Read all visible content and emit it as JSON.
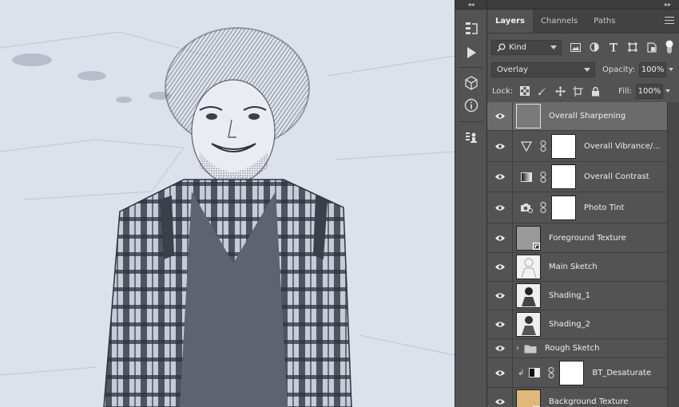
{
  "panel": {
    "tabs": [
      {
        "label": "Layers",
        "active": true
      },
      {
        "label": "Channels",
        "active": false
      },
      {
        "label": "Paths",
        "active": false
      }
    ],
    "filter_kind": "Kind",
    "blend_mode": "Overlay",
    "opacity_label": "Opacity:",
    "opacity_value": "100%",
    "lock_label": "Lock:",
    "fill_label": "Fill:",
    "fill_value": "100%"
  },
  "layers": [
    {
      "name": "Overall Sharpening",
      "selected": true,
      "kind": "pixel",
      "thumb_color": "#7a7a7a"
    },
    {
      "name": "Overall Vibrance/...",
      "kind": "adjustment",
      "adj_icon": "vibrance-triangle-icon"
    },
    {
      "name": "Overall Contrast",
      "kind": "adjustment",
      "adj_icon": "gradient-map-icon"
    },
    {
      "name": "Photo Tint",
      "kind": "adjustment",
      "adj_icon": "camera-tint-icon"
    },
    {
      "name": "Foreground Texture",
      "kind": "smart",
      "thumb_color": "#9a9a9a"
    },
    {
      "name": "Main Sketch",
      "kind": "pixel",
      "thumb_color": "#f2f2f2"
    },
    {
      "name": "Shading_1",
      "kind": "pixel",
      "thumb_color": "#efefef"
    },
    {
      "name": "Shading_2",
      "kind": "pixel",
      "thumb_color": "#efefef"
    },
    {
      "name": "Rough Sketch",
      "kind": "group"
    },
    {
      "name": "BT_Desaturate",
      "kind": "clipped-adjustment",
      "adj_icon": "black-white-icon"
    },
    {
      "name": "Background Texture",
      "kind": "smart",
      "thumb_color": "#e0b878"
    }
  ],
  "colors": {
    "panel_bg": "#535353",
    "selected_row": "#6b6b6b",
    "canvas_bg": "#d9dde8"
  }
}
